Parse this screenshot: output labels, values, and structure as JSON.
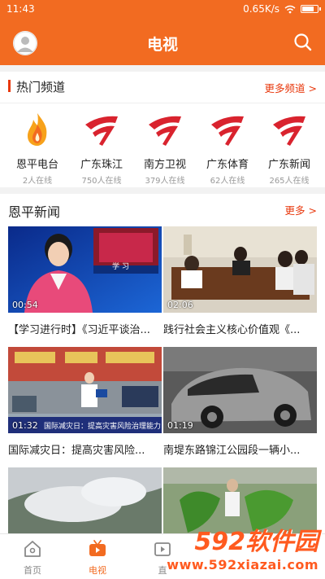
{
  "status_bar": {
    "time": "11:43",
    "network_speed": "0.65K/s",
    "battery_level": 0.85
  },
  "header": {
    "title": "电视"
  },
  "hot_channels": {
    "title": "热门频道",
    "more_label": "更多频道 >",
    "items": [
      {
        "name": "恩平电台",
        "viewers": "2人在线",
        "logo": "flame-logo"
      },
      {
        "name": "广东珠江",
        "viewers": "750人在线",
        "logo": "gdtv-logo"
      },
      {
        "name": "南方卫视",
        "viewers": "379人在线",
        "logo": "gdtv-logo"
      },
      {
        "name": "广东体育",
        "viewers": "62人在线",
        "logo": "gdtv-logo"
      },
      {
        "name": "广东新闻",
        "viewers": "265人在线",
        "logo": "gdtv-logo"
      }
    ]
  },
  "news": {
    "title": "恩平新闻",
    "more_label": "更多 >",
    "items": [
      {
        "duration": "00:54",
        "headline": "【学习进行时】《习近平谈治...",
        "thumb_overlay": "学 习"
      },
      {
        "duration": "02:06",
        "headline": "践行社会主义核心价值观《..."
      },
      {
        "duration": "01:32",
        "headline": "国际减灾日：提高灾害风险...",
        "thumb_overlay": "国际减灾日：提高灾害风险治理能力"
      },
      {
        "duration": "01:19",
        "headline": "南堤东路锦江公园段一辆小..."
      },
      {
        "duration": "",
        "headline": ""
      },
      {
        "duration": "",
        "headline": ""
      }
    ]
  },
  "tabs": [
    {
      "label": "首页",
      "icon": "home-icon",
      "active": false
    },
    {
      "label": "电视",
      "icon": "tv-icon",
      "active": true
    },
    {
      "label": "直",
      "icon": "live-icon",
      "active": false
    }
  ],
  "watermark": {
    "text": "592软件园",
    "url": "www.592xiazai.com"
  },
  "colors": {
    "brand_orange": "#f26b21",
    "accent_red": "#e8380d",
    "gdtv_red": "#d9232e"
  }
}
